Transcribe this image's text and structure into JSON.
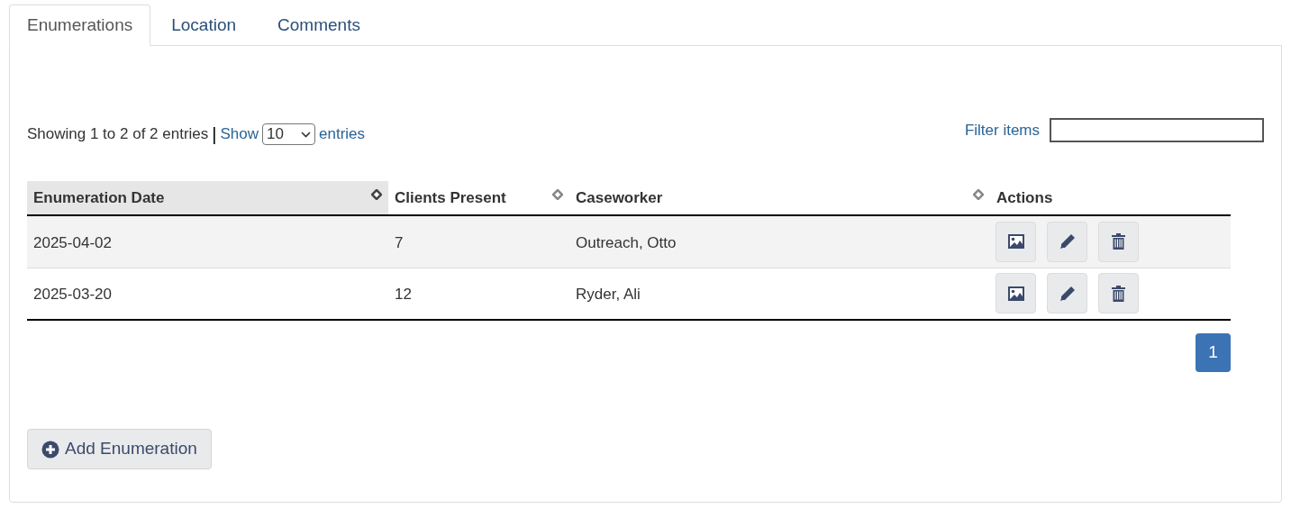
{
  "tabs": [
    {
      "label": "Enumerations",
      "selected": true
    },
    {
      "label": "Location",
      "selected": false
    },
    {
      "label": "Comments",
      "selected": false
    }
  ],
  "summary": "Showing 1 to 2 of 2 entries",
  "separator": "|",
  "show_label": "Show",
  "page_size": "10",
  "entries_label": "entries",
  "filter": {
    "label": "Filter items"
  },
  "table": {
    "columns": [
      {
        "label": "Enumeration Date",
        "sortable": true,
        "sorted": true
      },
      {
        "label": "Clients Present",
        "sortable": true,
        "sorted": false
      },
      {
        "label": "Caseworker",
        "sortable": true,
        "sorted": false
      },
      {
        "label": "Actions",
        "sortable": false,
        "sorted": false
      }
    ],
    "rows": [
      {
        "cells": [
          "2025-04-02",
          "7",
          "Outreach, Otto"
        ]
      },
      {
        "cells": [
          "2025-03-20",
          "12",
          "Ryder, Ali"
        ]
      }
    ]
  },
  "pagination": [
    {
      "label": "1",
      "selected": true
    }
  ],
  "add_button": "Add Enumeration"
}
